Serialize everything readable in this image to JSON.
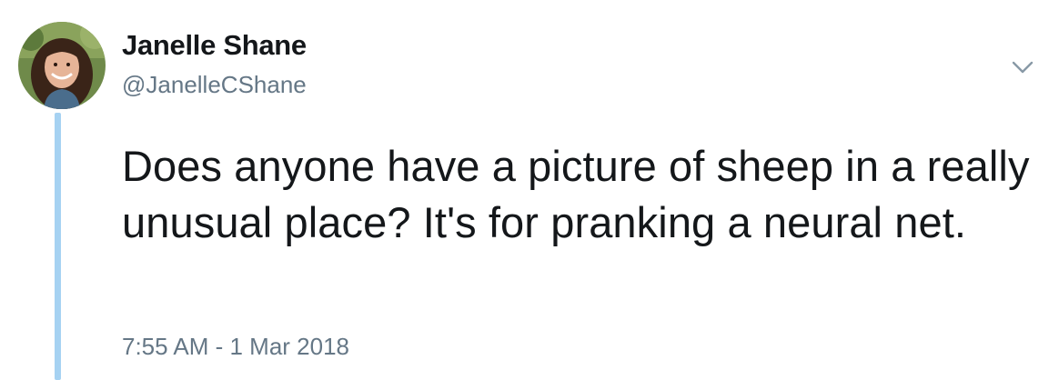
{
  "tweet": {
    "author": {
      "display_name": "Janelle Shane",
      "handle": "@JanelleCShane",
      "avatar_icon": "profile-photo"
    },
    "text": "Does anyone have a picture of sheep in a really unusual place? It's for pranking a neural net.",
    "timestamp": "7:55 AM - 1 Mar 2018",
    "menu_icon": "chevron-down-icon"
  },
  "colors": {
    "text_primary": "#14171a",
    "text_secondary": "#657786",
    "thread_line": "#a6d2f2",
    "background": "#ffffff"
  }
}
